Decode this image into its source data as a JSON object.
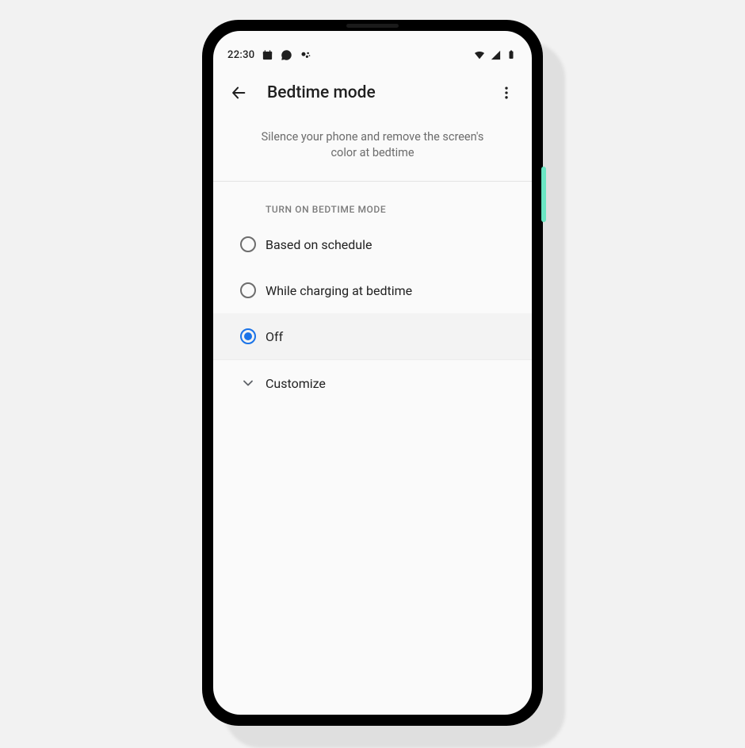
{
  "status": {
    "time": "22:30"
  },
  "appbar": {
    "title": "Bedtime mode"
  },
  "subtitle": "Silence your phone and remove the screen's color at bedtime",
  "section_header": "TURN ON BEDTIME MODE",
  "options": [
    {
      "label": "Based on schedule",
      "selected": false
    },
    {
      "label": "While charging at bedtime",
      "selected": false
    },
    {
      "label": "Off",
      "selected": true
    }
  ],
  "customize_label": "Customize"
}
